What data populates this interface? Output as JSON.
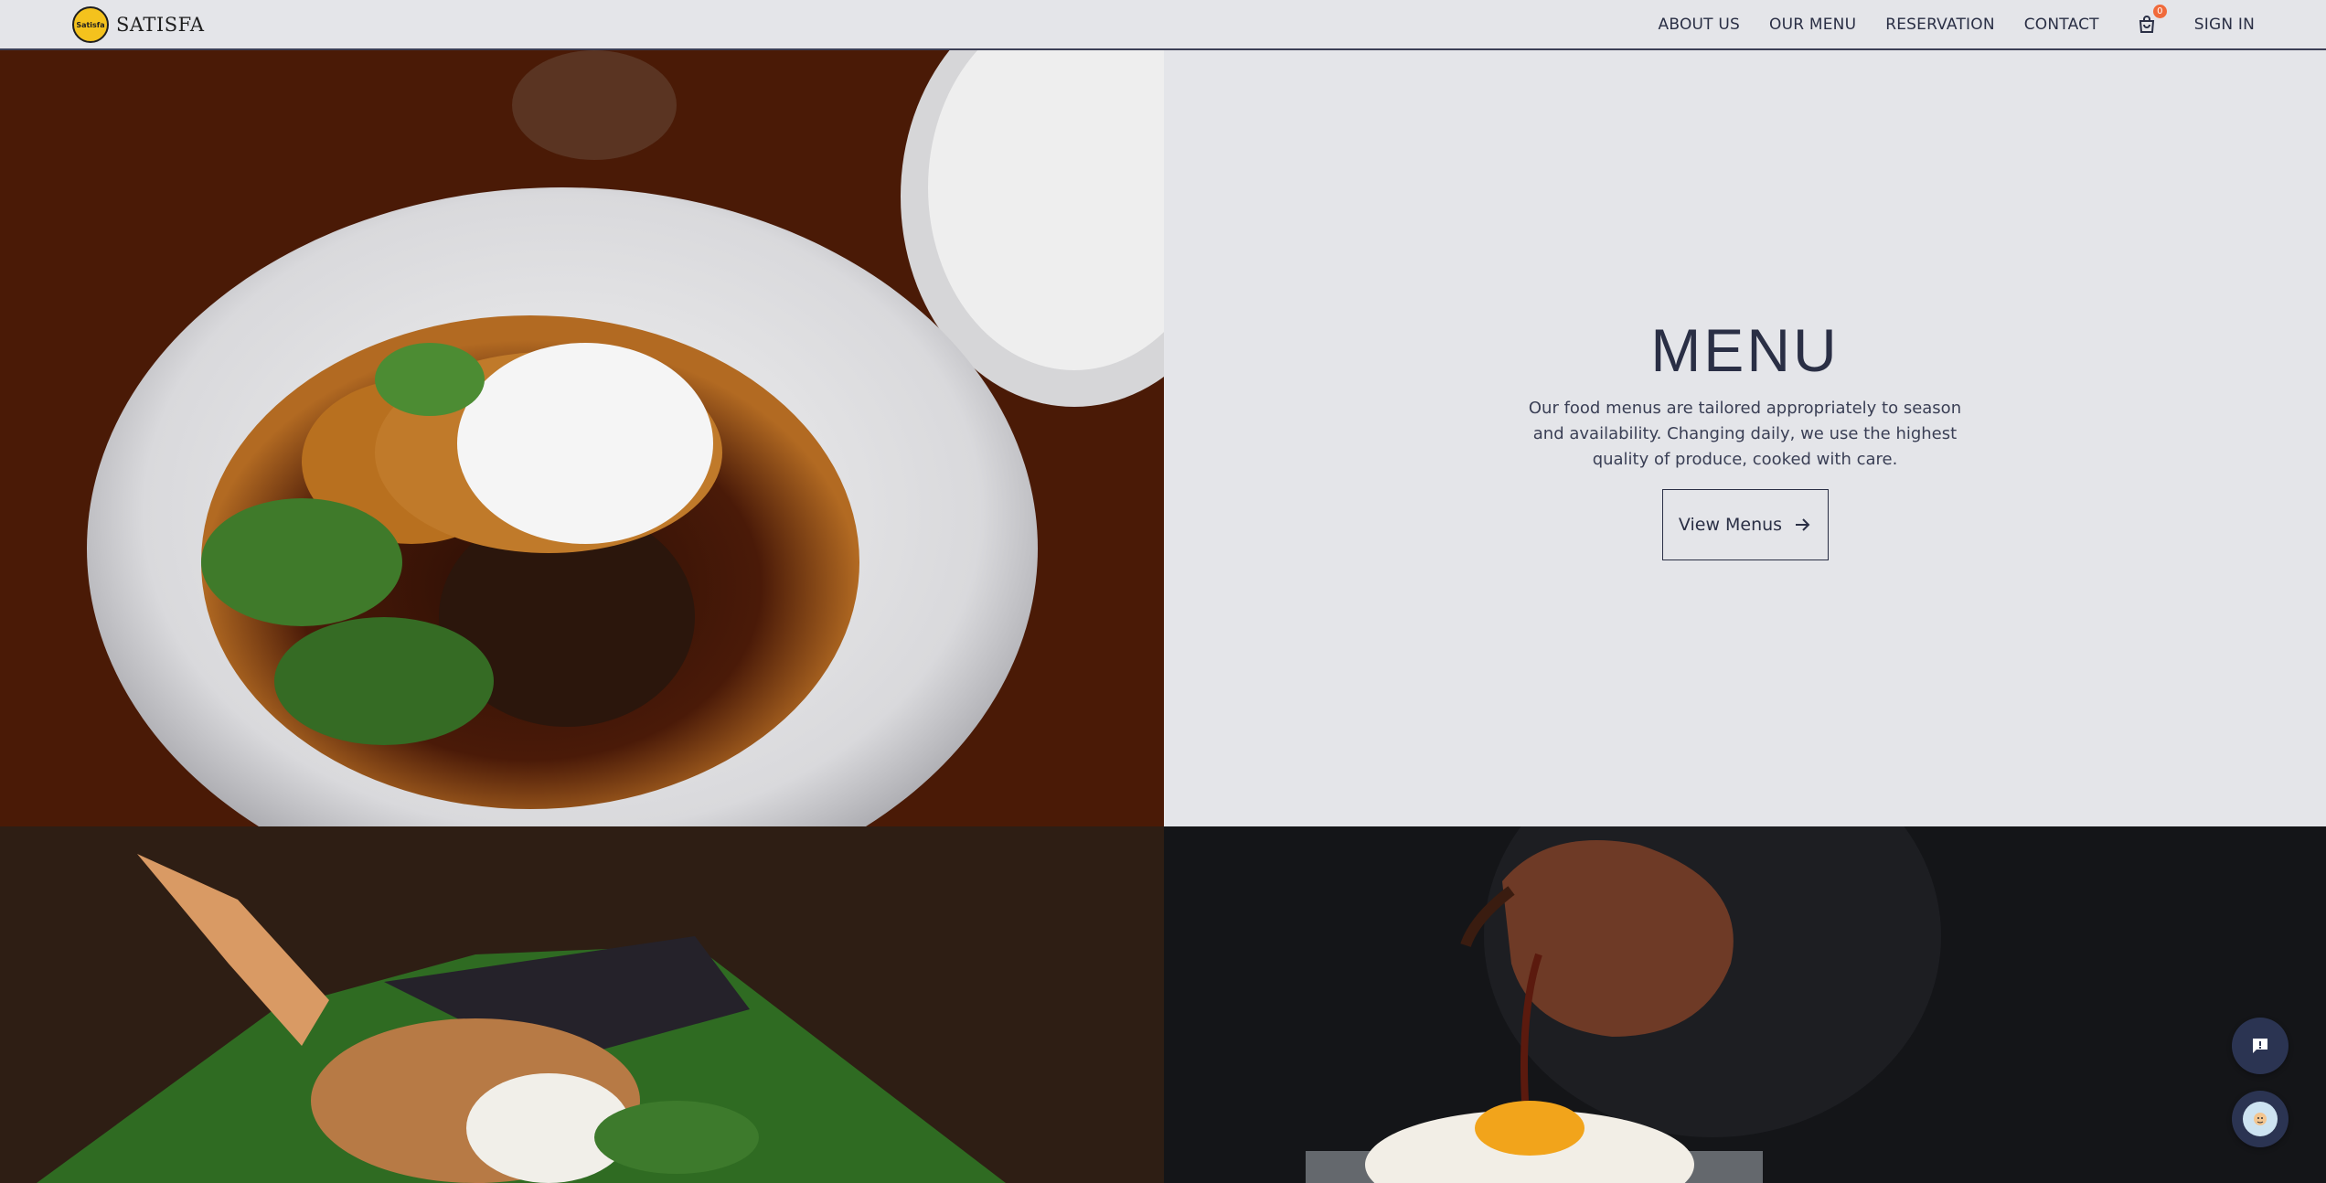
{
  "brand": {
    "logo_text": "SATISFA",
    "badge_text": "Satisfa"
  },
  "nav": {
    "items": [
      "ABOUT US",
      "OUR MENU",
      "RESERVATION",
      "CONTACT"
    ],
    "cart_count": "0",
    "signin_label": "SIGN IN"
  },
  "menu_section": {
    "title": "MENU",
    "description": "Our food menus are tailored appropriately to season and availability. Changing daily, we use the highest quality of produce, cooked with care.",
    "button_label": "View Menus"
  },
  "colors": {
    "background": "#e4e5e9",
    "text": "#2a2f45",
    "accent_logo": "#f4c21d",
    "badge": "#f06a3b",
    "fab": "#2b3452"
  },
  "icons": [
    "shopping-bag-icon",
    "arrow-right-icon",
    "feedback-icon",
    "chat-avatar-icon"
  ]
}
